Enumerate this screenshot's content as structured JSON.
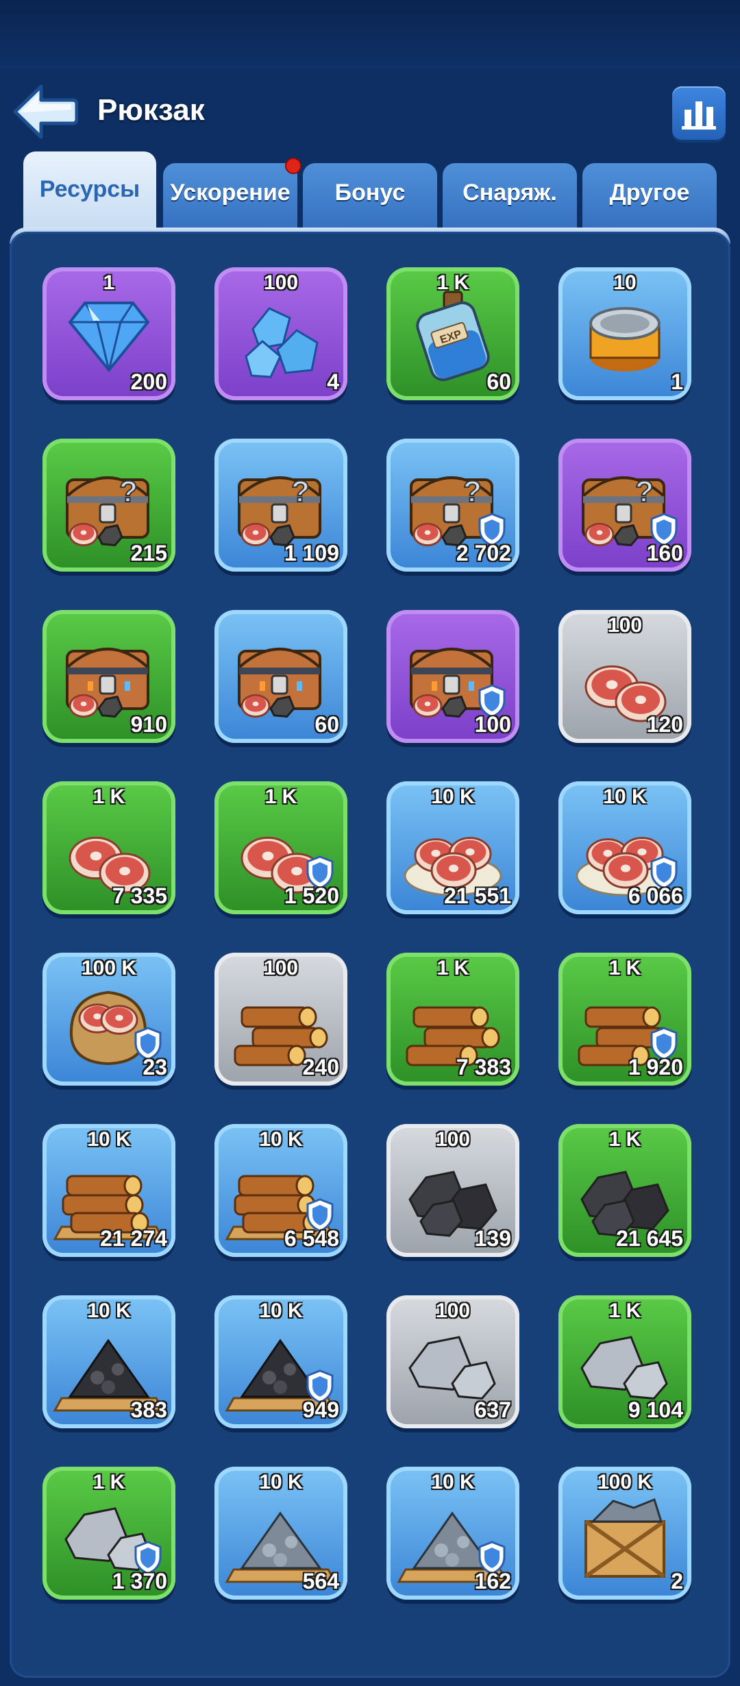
{
  "header": {
    "title": "Рюкзак",
    "back_icon": "back-arrow-icon",
    "stats_icon": "bar-chart-icon"
  },
  "tabs": [
    {
      "label": "Ресурсы",
      "active": true,
      "dot": false
    },
    {
      "label": "Ускорение",
      "active": false,
      "dot": true
    },
    {
      "label": "Бонус",
      "active": false,
      "dot": false
    },
    {
      "label": "Снаряж.",
      "active": false,
      "dot": false
    },
    {
      "label": "Другое",
      "active": false,
      "dot": false
    }
  ],
  "colors": {
    "purple": "#8b4fd6",
    "green": "#3aa82f",
    "blue": "#4d95dd",
    "gray": "#b6bbc2",
    "background": "#0e2f63"
  },
  "items": [
    {
      "label": "1",
      "count": "200",
      "rarity": "purple",
      "icon": "diamond-icon",
      "shield": false
    },
    {
      "label": "100",
      "count": "4",
      "rarity": "purple",
      "icon": "crystals-icon",
      "shield": false
    },
    {
      "label": "1 K",
      "count": "60",
      "rarity": "green",
      "icon": "exp-potion-icon",
      "shield": false
    },
    {
      "label": "10",
      "count": "1",
      "rarity": "blue",
      "icon": "can-icon",
      "shield": false
    },
    {
      "label": "",
      "count": "215",
      "rarity": "green",
      "icon": "mystery-chest-icon",
      "shield": false
    },
    {
      "label": "",
      "count": "1 109",
      "rarity": "blue",
      "icon": "mystery-chest-icon",
      "shield": false
    },
    {
      "label": "",
      "count": "2 702",
      "rarity": "blue",
      "icon": "mystery-chest-icon",
      "shield": true
    },
    {
      "label": "",
      "count": "160",
      "rarity": "purple",
      "icon": "mystery-chest-icon",
      "shield": true
    },
    {
      "label": "",
      "count": "910",
      "rarity": "green",
      "icon": "iron-chest-icon",
      "shield": false
    },
    {
      "label": "",
      "count": "60",
      "rarity": "blue",
      "icon": "iron-chest-icon",
      "shield": false
    },
    {
      "label": "",
      "count": "100",
      "rarity": "purple",
      "icon": "iron-chest-icon",
      "shield": true
    },
    {
      "label": "100",
      "count": "120",
      "rarity": "gray",
      "icon": "meat-icon",
      "shield": false
    },
    {
      "label": "1 K",
      "count": "7 335",
      "rarity": "green",
      "icon": "meat-icon",
      "shield": false
    },
    {
      "label": "1 K",
      "count": "1 520",
      "rarity": "green",
      "icon": "meat-icon",
      "shield": true
    },
    {
      "label": "10 K",
      "count": "21 551",
      "rarity": "blue",
      "icon": "meat-plate-icon",
      "shield": false
    },
    {
      "label": "10 K",
      "count": "6 066",
      "rarity": "blue",
      "icon": "meat-plate-icon",
      "shield": true
    },
    {
      "label": "100 K",
      "count": "23",
      "rarity": "blue",
      "icon": "meat-sack-icon",
      "shield": true
    },
    {
      "label": "100",
      "count": "240",
      "rarity": "gray",
      "icon": "wood-icon",
      "shield": false
    },
    {
      "label": "1 K",
      "count": "7 383",
      "rarity": "green",
      "icon": "wood-icon",
      "shield": false
    },
    {
      "label": "1 K",
      "count": "1 920",
      "rarity": "green",
      "icon": "wood-icon",
      "shield": true
    },
    {
      "label": "10 K",
      "count": "21 274",
      "rarity": "blue",
      "icon": "wood-pallet-icon",
      "shield": false
    },
    {
      "label": "10 K",
      "count": "6 548",
      "rarity": "blue",
      "icon": "wood-pallet-icon",
      "shield": true
    },
    {
      "label": "100",
      "count": "139",
      "rarity": "gray",
      "icon": "coal-icon",
      "shield": false
    },
    {
      "label": "1 K",
      "count": "21 645",
      "rarity": "green",
      "icon": "coal-icon",
      "shield": false
    },
    {
      "label": "10 K",
      "count": "383",
      "rarity": "blue",
      "icon": "coal-pallet-icon",
      "shield": false
    },
    {
      "label": "10 K",
      "count": "949",
      "rarity": "blue",
      "icon": "coal-pallet-icon",
      "shield": true
    },
    {
      "label": "100",
      "count": "637",
      "rarity": "gray",
      "icon": "stone-icon",
      "shield": false
    },
    {
      "label": "1 K",
      "count": "9 104",
      "rarity": "green",
      "icon": "stone-icon",
      "shield": false
    },
    {
      "label": "1 K",
      "count": "1 370",
      "rarity": "green",
      "icon": "stone-icon",
      "shield": true
    },
    {
      "label": "10 K",
      "count": "564",
      "rarity": "blue",
      "icon": "iron-pallet-icon",
      "shield": false
    },
    {
      "label": "10 K",
      "count": "162",
      "rarity": "blue",
      "icon": "iron-pallet-icon",
      "shield": true
    },
    {
      "label": "100 K",
      "count": "2",
      "rarity": "blue",
      "icon": "iron-crate-icon",
      "shield": false
    }
  ]
}
